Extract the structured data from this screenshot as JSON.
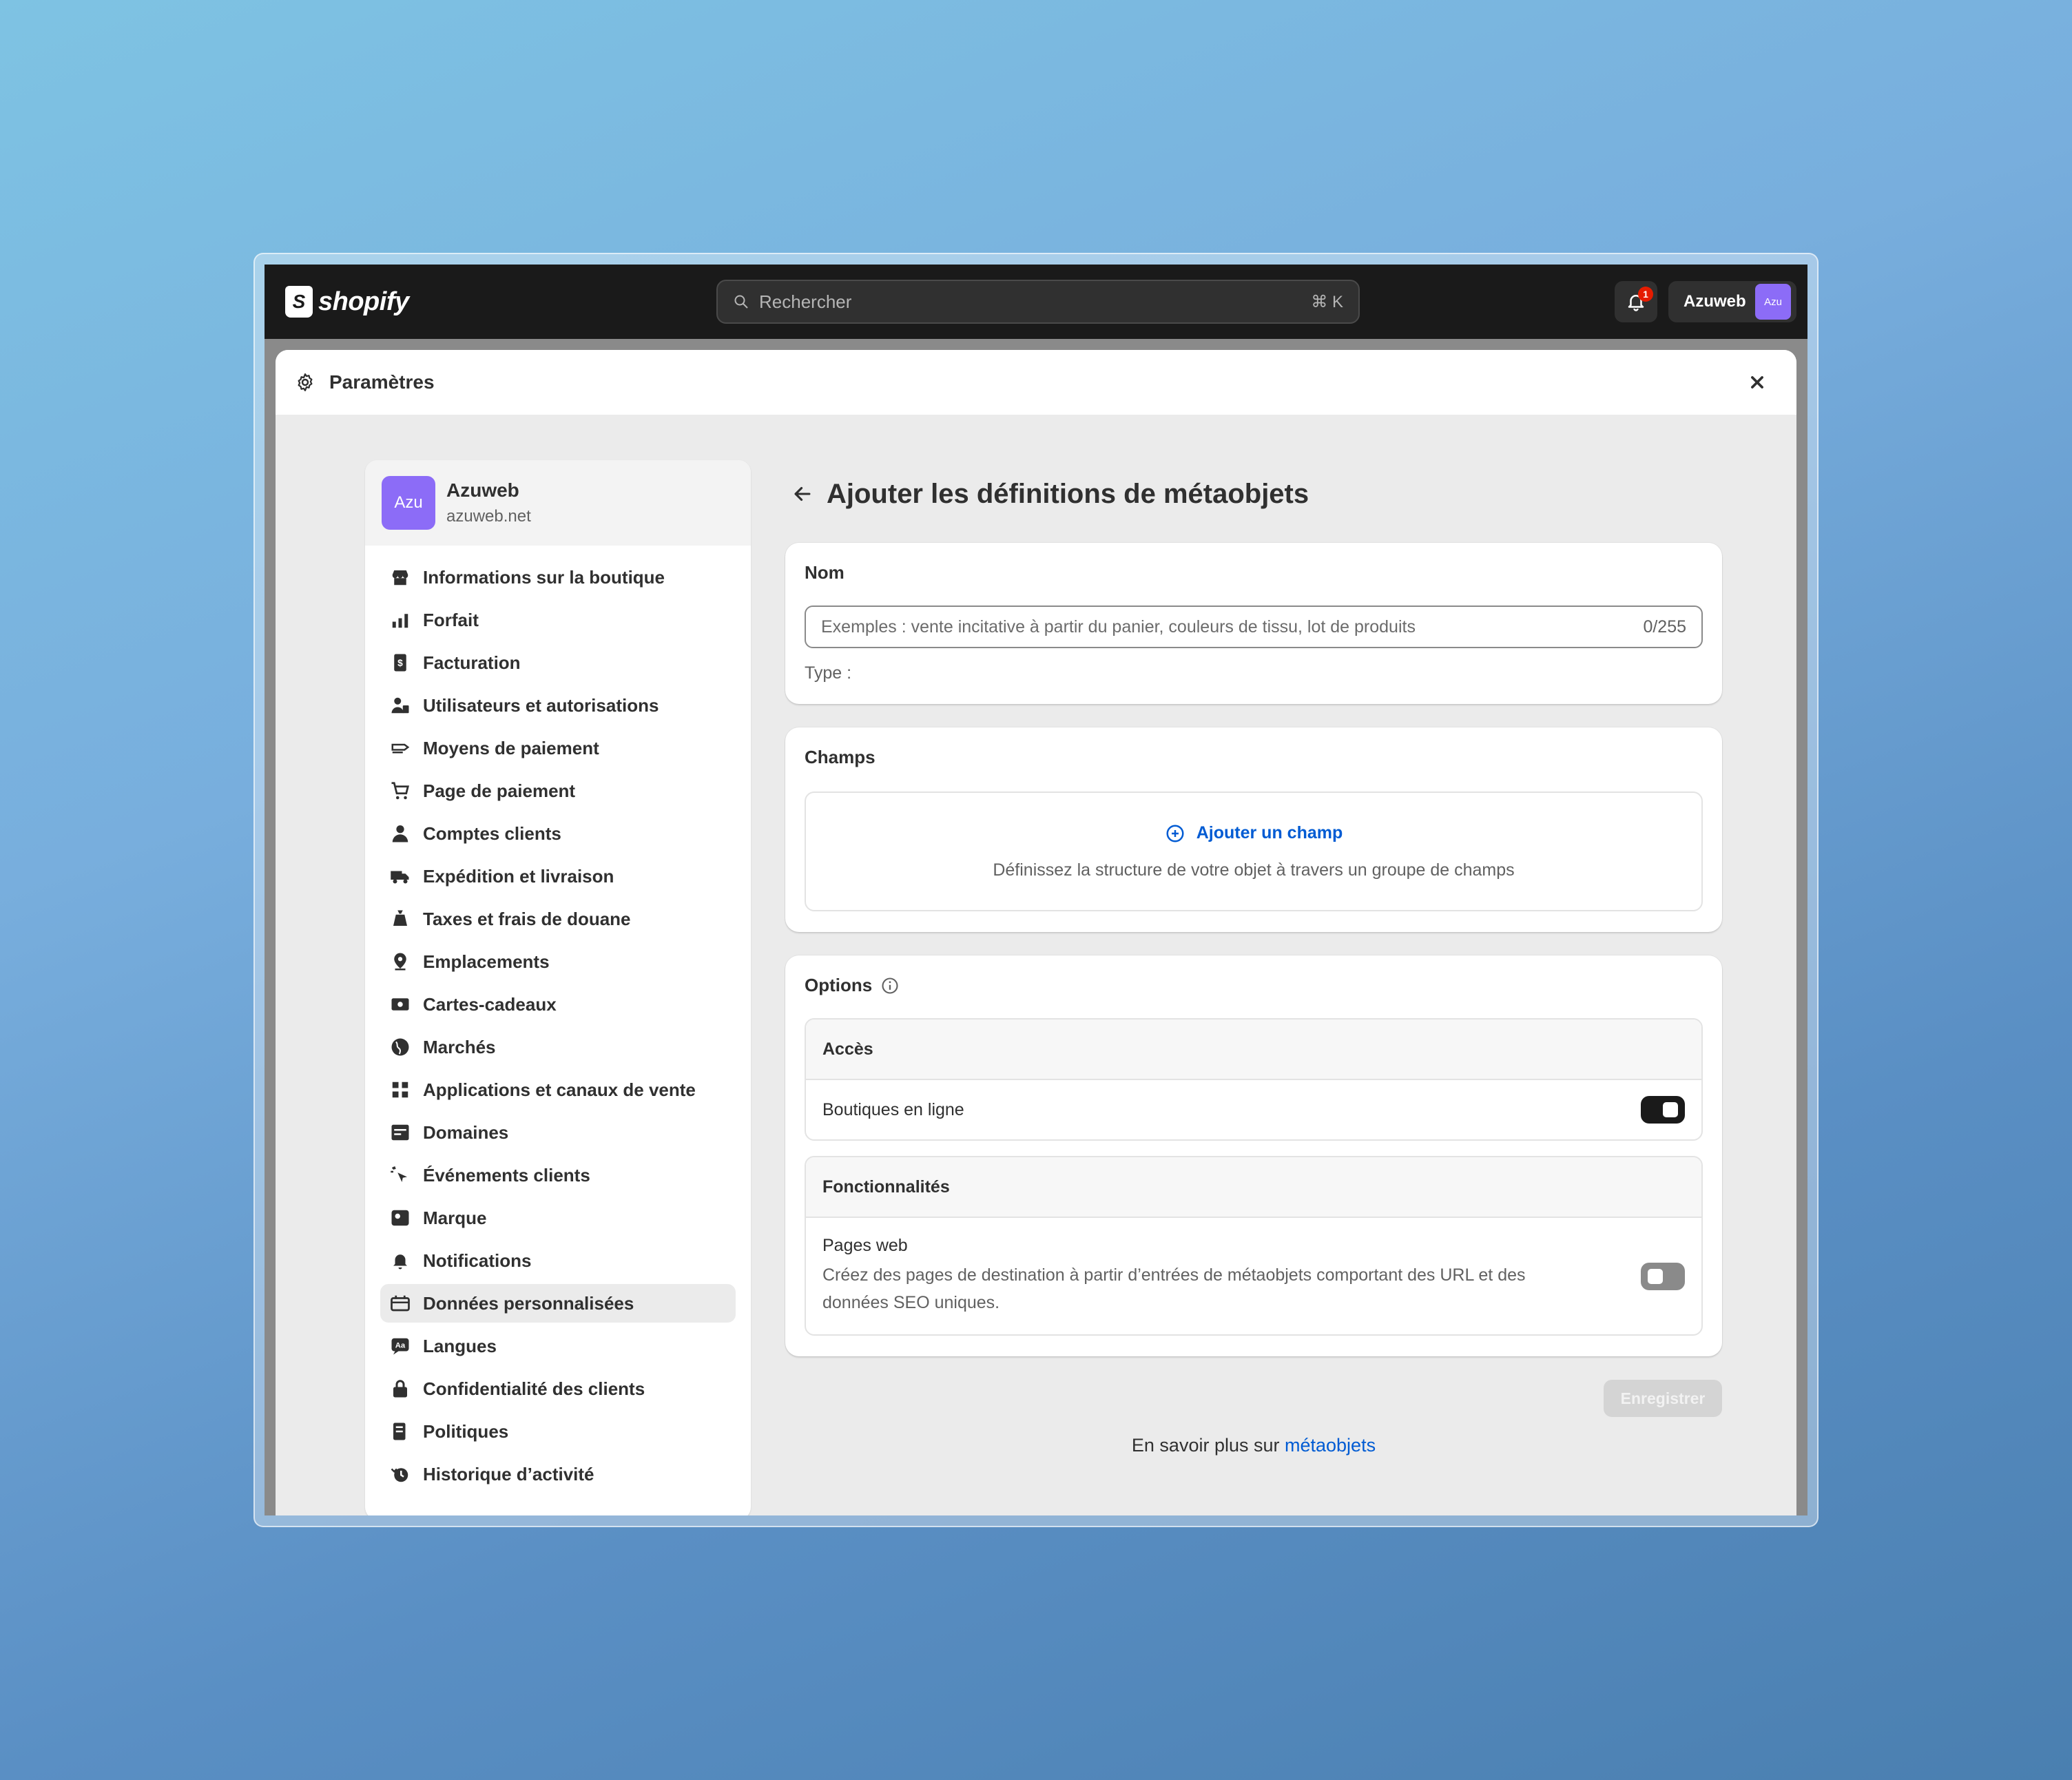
{
  "topbar": {
    "logo_text": "shopify",
    "search_placeholder": "Rechercher",
    "search_shortcut": "⌘ K",
    "notification_count": "1",
    "account_name": "Azuweb",
    "account_avatar": "Azu"
  },
  "modal": {
    "title": "Paramètres"
  },
  "sidebar": {
    "store_avatar": "Azu",
    "store_name": "Azuweb",
    "store_domain": "azuweb.net",
    "items": [
      {
        "label": "Informations sur la boutique",
        "icon": "store-icon"
      },
      {
        "label": "Forfait",
        "icon": "plan-icon"
      },
      {
        "label": "Facturation",
        "icon": "billing-icon"
      },
      {
        "label": "Utilisateurs et autorisations",
        "icon": "users-icon"
      },
      {
        "label": "Moyens de paiement",
        "icon": "payment-icon"
      },
      {
        "label": "Page de paiement",
        "icon": "cart-icon"
      },
      {
        "label": "Comptes clients",
        "icon": "person-icon"
      },
      {
        "label": "Expédition et livraison",
        "icon": "truck-icon"
      },
      {
        "label": "Taxes et frais de douane",
        "icon": "tax-icon"
      },
      {
        "label": "Emplacements",
        "icon": "location-icon"
      },
      {
        "label": "Cartes-cadeaux",
        "icon": "gift-card-icon"
      },
      {
        "label": "Marchés",
        "icon": "globe-icon"
      },
      {
        "label": "Applications et canaux de vente",
        "icon": "apps-icon"
      },
      {
        "label": "Domaines",
        "icon": "domain-icon"
      },
      {
        "label": "Événements clients",
        "icon": "cursor-click-icon"
      },
      {
        "label": "Marque",
        "icon": "brand-icon"
      },
      {
        "label": "Notifications",
        "icon": "bell-icon"
      },
      {
        "label": "Données personnalisées",
        "icon": "custom-data-icon"
      },
      {
        "label": "Langues",
        "icon": "language-icon"
      },
      {
        "label": "Confidentialité des clients",
        "icon": "lock-icon"
      },
      {
        "label": "Politiques",
        "icon": "policy-icon"
      },
      {
        "label": "Historique d’activité",
        "icon": "history-icon"
      }
    ],
    "active_index": 17
  },
  "main": {
    "page_title": "Ajouter les définitions de métaobjets",
    "name_card": {
      "title": "Nom",
      "input_placeholder": "Exemples : vente incitative à partir du panier, couleurs de tissu, lot de produits",
      "input_value": "",
      "counter": "0/255",
      "type_label": "Type :"
    },
    "fields_card": {
      "title": "Champs",
      "add_label": "Ajouter un champ",
      "description": "Définissez la structure de votre objet à travers un groupe de champs"
    },
    "options_card": {
      "title": "Options",
      "access": {
        "heading": "Accès",
        "row_label": "Boutiques en ligne",
        "enabled": true
      },
      "features": {
        "heading": "Fonctionnalités",
        "row_label": "Pages web",
        "row_description": "Créez des pages de destination à partir d’entrées de métaobjets comportant des URL et des données SEO uniques.",
        "enabled": false
      }
    },
    "save_label": "Enregistrer",
    "learn_more_prefix": "En savoir plus sur ",
    "learn_more_link": "métaobjets"
  },
  "colors": {
    "accent_link": "#005bd3",
    "avatar": "#8c6cf7",
    "topbar": "#1a1a1a",
    "notification_badge": "#e51c00"
  }
}
